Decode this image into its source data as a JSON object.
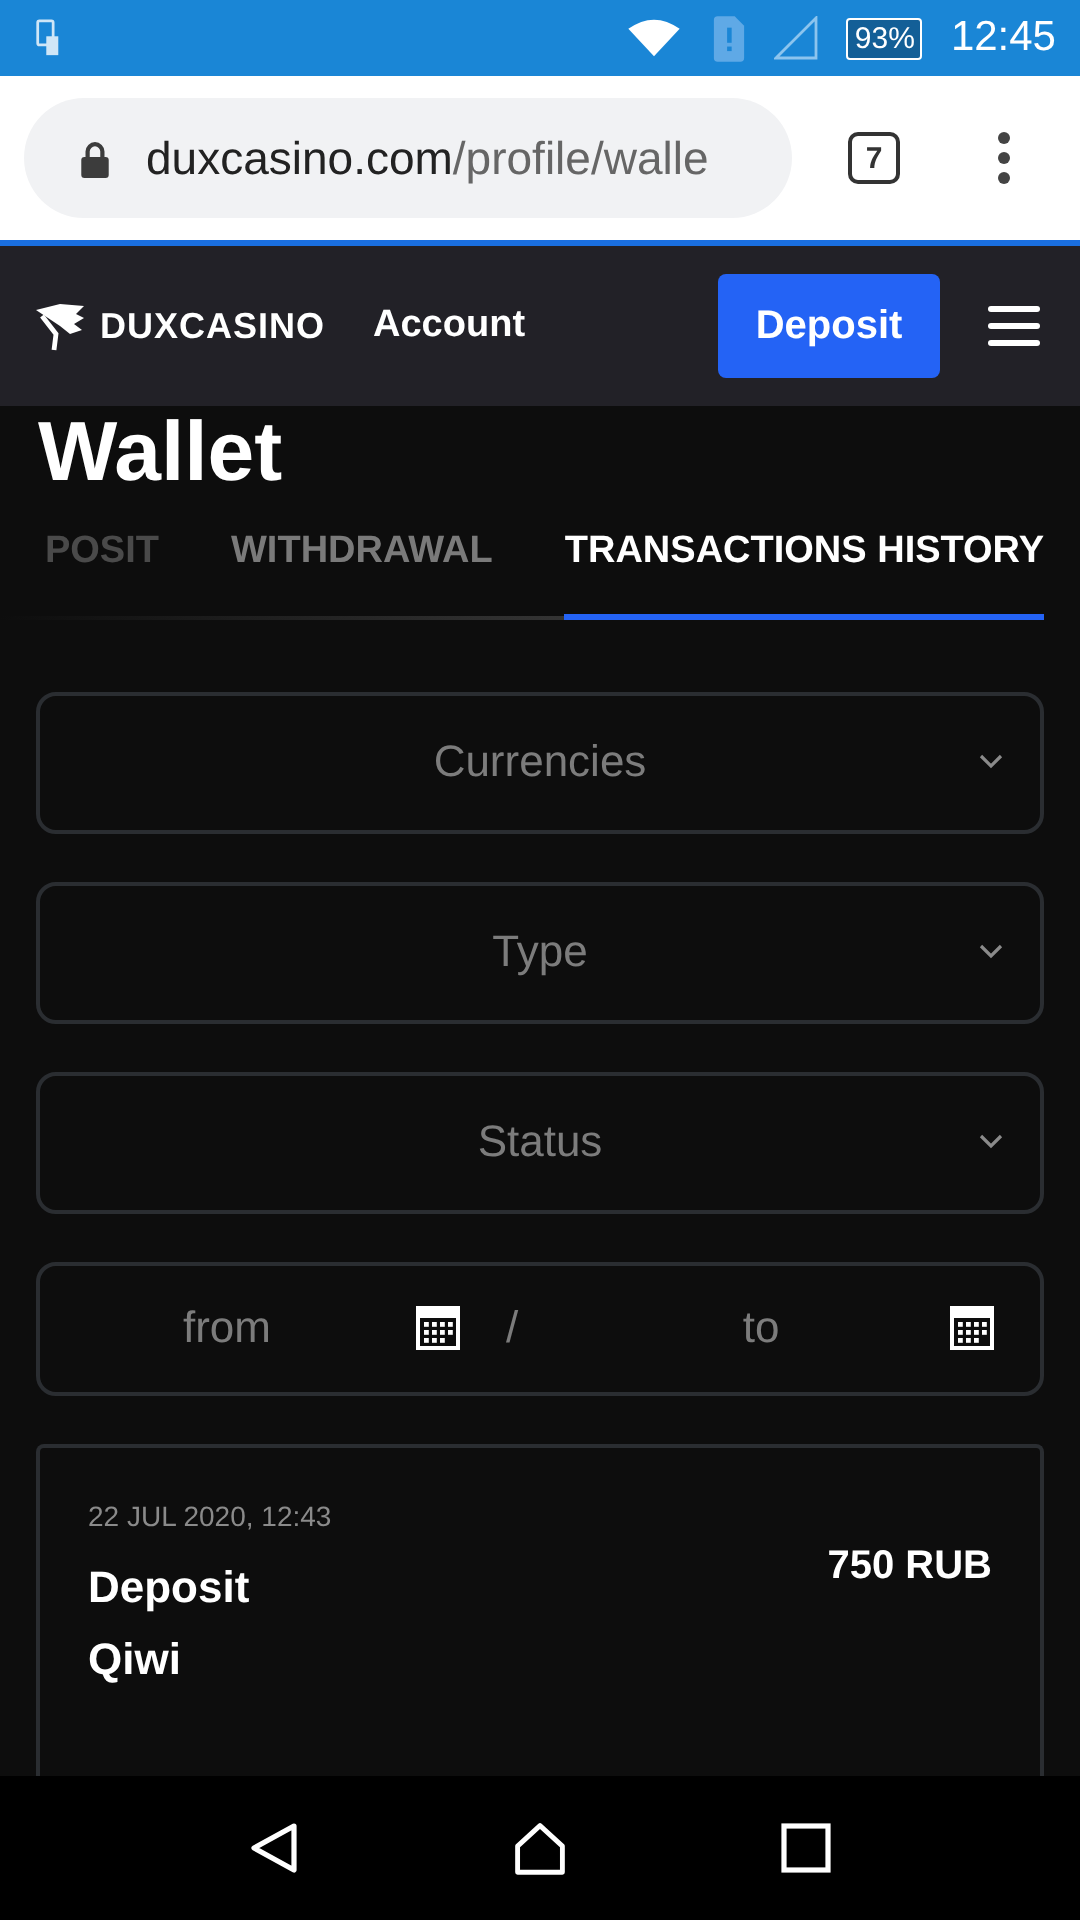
{
  "status_bar": {
    "battery": "93%",
    "time": "12:45"
  },
  "browser": {
    "url_host": "duxcasino.com",
    "url_path": "/profile/walle",
    "tab_count": "7"
  },
  "header": {
    "logo": "DUXCASINO",
    "nav_link": "Account",
    "deposit_button": "Deposit"
  },
  "page_title": "Wallet",
  "tabs": [
    {
      "label": "POSIT",
      "selected": false
    },
    {
      "label": "WITHDRAWAL",
      "selected": false
    },
    {
      "label": "TRANSACTIONS HISTORY",
      "selected": true
    }
  ],
  "filters": [
    {
      "placeholder": "Currencies"
    },
    {
      "placeholder": "Type"
    },
    {
      "placeholder": "Status"
    }
  ],
  "date_range": {
    "from_placeholder": "from",
    "separator": "/",
    "to_placeholder": "to"
  },
  "transactions": [
    {
      "date": "22 JUL 2020, 12:43",
      "type": "Deposit",
      "method": "Qiwi",
      "amount": "750 RUB"
    }
  ]
}
